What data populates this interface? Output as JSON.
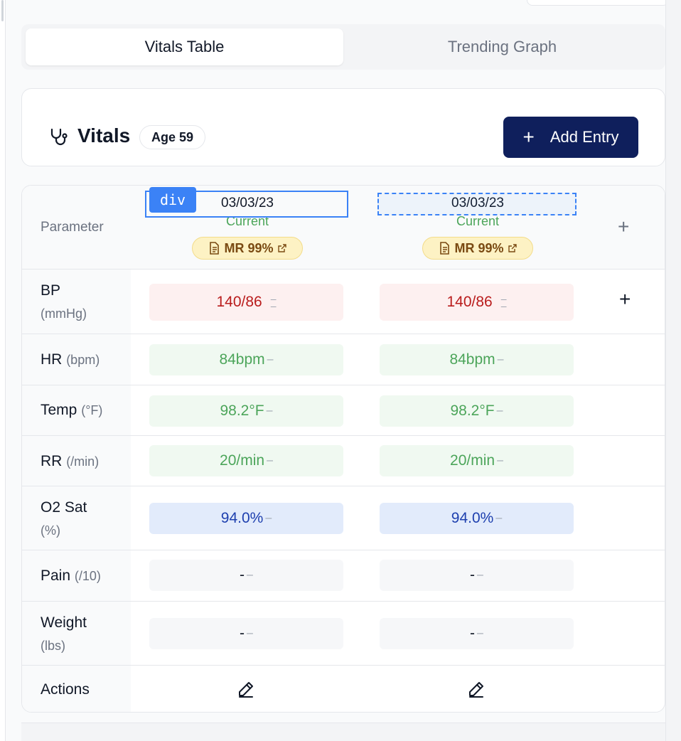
{
  "tabs": {
    "vitals_table": "Vitals Table",
    "trending_graph": "Trending Graph"
  },
  "header": {
    "title": "Vitals",
    "age_badge": "Age 59",
    "add_entry": "Add Entry"
  },
  "table": {
    "parameter_header": "Parameter",
    "columns": [
      {
        "date": "03/03/23",
        "status": "Current",
        "mr_badge": "MR 99%"
      },
      {
        "date": "03/03/23",
        "status": "Current",
        "mr_badge": "MR 99%"
      }
    ],
    "inspector_tag": "div",
    "rows": [
      {
        "label": "BP",
        "unit": "(mmHg)",
        "values": [
          "140/86",
          "140/86"
        ]
      },
      {
        "label": "HR",
        "unit": "(bpm)",
        "values": [
          "84bpm",
          "84bpm"
        ]
      },
      {
        "label": "Temp",
        "unit": "(°F)",
        "values": [
          "98.2°F",
          "98.2°F"
        ]
      },
      {
        "label": "RR",
        "unit": "(/min)",
        "values": [
          "20/min",
          "20/min"
        ]
      },
      {
        "label": "O2 Sat",
        "unit": "(%)",
        "values": [
          "94.0%",
          "94.0%"
        ]
      },
      {
        "label": "Pain",
        "unit": "(/10)",
        "values": [
          "-",
          "-"
        ]
      },
      {
        "label": "Weight",
        "unit": "(lbs)",
        "values": [
          "-",
          "-"
        ]
      }
    ],
    "actions_label": "Actions"
  },
  "colors": {
    "primary_button": "#0f1f5c",
    "status_current": "#4ca55a",
    "bp_high_text": "#b91c1c",
    "o2_text": "#1e40af",
    "mr_badge_bg": "#fdf2c4"
  }
}
